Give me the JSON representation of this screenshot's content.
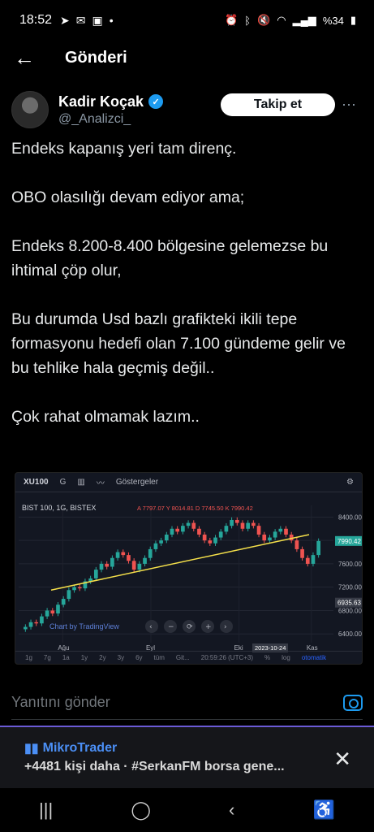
{
  "status": {
    "time": "18:52",
    "left_icons": [
      "send-icon",
      "message-icon",
      "box-icon",
      "dot-icon"
    ],
    "battery": "%34"
  },
  "header": {
    "title": "Gönderi"
  },
  "author": {
    "name": "Kadir Koçak",
    "handle": "@_Analizci_",
    "follow_label": "Takip et",
    "verified_color": "#1d9bf0"
  },
  "tweet": {
    "paragraphs": [
      "Endeks kapanış yeri tam direnç.",
      "OBO olasılığı devam ediyor ama;",
      "Endeks 8.200-8.400 bölgesine gelemezse bu ihtimal çöp olur,",
      "Bu durumda Usd bazlı grafikteki ikili tepe formasyonu hedefi olan 7.100 gündeme gelir ve bu tehlike hala geçmiş değil..",
      "Çok rahat olmamak lazım.."
    ]
  },
  "chart": {
    "toolbar": {
      "symbol": "XU100",
      "interval": "G",
      "indicators": "Göstergeler"
    },
    "legend": "BIST 100, 1G, BISTEX",
    "ohlc": "A 7797.07  Y 8014.81  D 7745.50  K 7990.42",
    "watermark": "Chart by TradingView",
    "last_price": "7990.42",
    "support_price": "6935.63",
    "x_labels": [
      "Ağu",
      "Eyl",
      "Eki",
      "Kas"
    ],
    "date_label": "2023-10-24",
    "footer": [
      "1g",
      "7g",
      "1a",
      "1y",
      "2y",
      "3y",
      "6y",
      "tüm",
      "Git...",
      "20:59:26 (UTC+3)",
      "%",
      "log",
      "otomatik"
    ]
  },
  "chart_data": {
    "type": "candlestick",
    "title": "BIST 100, 1G, BISTEX",
    "y_ticks": [
      6400,
      6800,
      7200,
      7600,
      8000,
      8400
    ],
    "ylim": [
      6250,
      8600
    ],
    "x_ticks": [
      "Ağu",
      "Eyl",
      "Eki",
      "Kas"
    ],
    "last_value": 7990.42,
    "marked_value": 6935.63,
    "trendline": {
      "from_value": 7150,
      "to_value": 8100
    },
    "closes": [
      6520,
      6600,
      6580,
      6700,
      6800,
      6750,
      6900,
      7000,
      7150,
      7200,
      7180,
      7300,
      7350,
      7500,
      7600,
      7550,
      7700,
      7800,
      7750,
      7650,
      7500,
      7600,
      7700,
      7850,
      7950,
      8000,
      8100,
      8200,
      8150,
      8250,
      8300,
      8200,
      8100,
      8000,
      7950,
      8050,
      8150,
      8250,
      8350,
      8300,
      8200,
      8300,
      8250,
      8100,
      8000,
      8050,
      8150,
      8200,
      8100,
      8000,
      7850,
      7700,
      7600,
      7750,
      7990
    ]
  },
  "reply": {
    "placeholder": "Yanıtını gönder"
  },
  "promo": {
    "title": "MikroTrader",
    "subtitle": "+4481 kişi daha · #SerkanFM borsa gene..."
  }
}
